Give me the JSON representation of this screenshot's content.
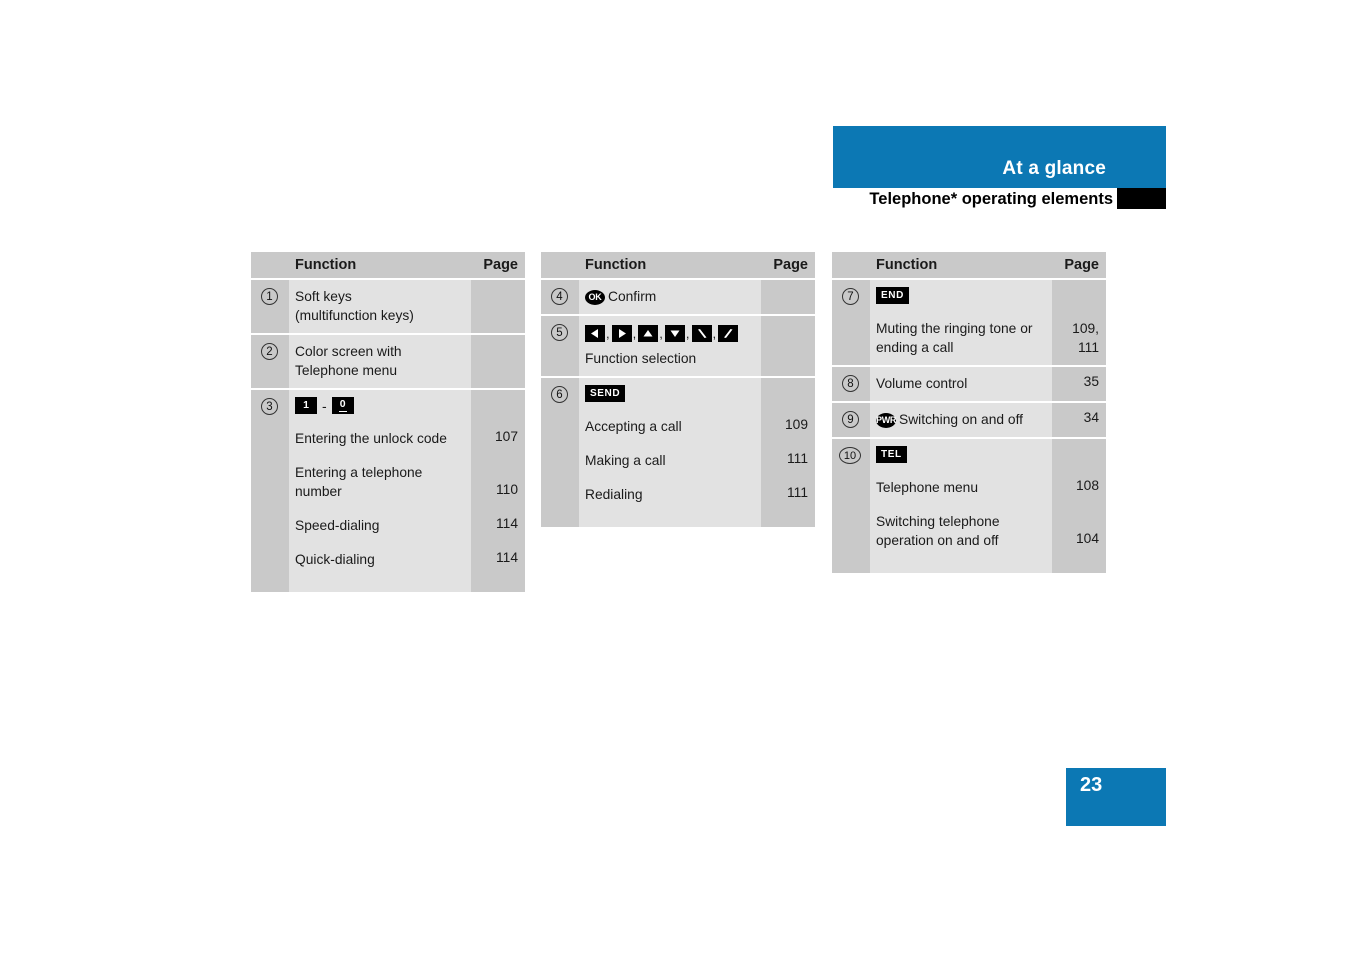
{
  "header": {
    "band_title": "At a glance",
    "section_title": "Telephone* operating elements",
    "accent_color": "#0c78b4"
  },
  "footer": {
    "page_number": "23"
  },
  "tables": {
    "col_headers": {
      "function": "Function",
      "page": "Page"
    },
    "table1": {
      "rows": [
        {
          "number": "1",
          "lines": [
            "Soft keys",
            "(multifunction keys)"
          ],
          "page": ""
        },
        {
          "number": "2",
          "lines": [
            "Color screen with",
            "Telephone menu"
          ],
          "page": ""
        },
        {
          "number": "3",
          "keys": {
            "from": "1",
            "to": "0",
            "separator": "-"
          },
          "entries": [
            {
              "text": "Entering the unlock code",
              "page": "107"
            },
            {
              "text": "Entering a telephone number",
              "page": "110"
            },
            {
              "text": "Speed-dialing",
              "page": "114"
            },
            {
              "text": "Quick-dialing",
              "page": "114"
            }
          ]
        }
      ]
    },
    "table2": {
      "rows": [
        {
          "number": "4",
          "ok_key": "OK",
          "label": "Confirm",
          "page": ""
        },
        {
          "number": "5",
          "arrow_keys": [
            "left-arrow",
            "right-arrow",
            "up-arrow",
            "down-arrow",
            "diagonal-down-arrow",
            "diagonal-up-arrow"
          ],
          "label": "Function selection",
          "page": ""
        },
        {
          "number": "6",
          "key": "SEND",
          "entries": [
            {
              "text": "Accepting a call",
              "page": "109"
            },
            {
              "text": "Making a call",
              "page": "111"
            },
            {
              "text": "Redialing",
              "page": "111"
            }
          ]
        }
      ]
    },
    "table3": {
      "rows": [
        {
          "number": "7",
          "key": "END",
          "entries": [
            {
              "text": "Muting the ringing tone or ending a call",
              "page_line1": "109,",
              "page_line2": "111"
            }
          ]
        },
        {
          "number": "8",
          "label": "Volume control",
          "page": "35"
        },
        {
          "number": "9",
          "pwr_key": "PWR",
          "label": "Switching on and off",
          "page": "34"
        },
        {
          "number": "10",
          "key": "TEL",
          "entries": [
            {
              "text": "Telephone menu",
              "page": "108"
            },
            {
              "text": "Switching telephone operation on and off",
              "page": "104"
            }
          ]
        }
      ]
    }
  }
}
